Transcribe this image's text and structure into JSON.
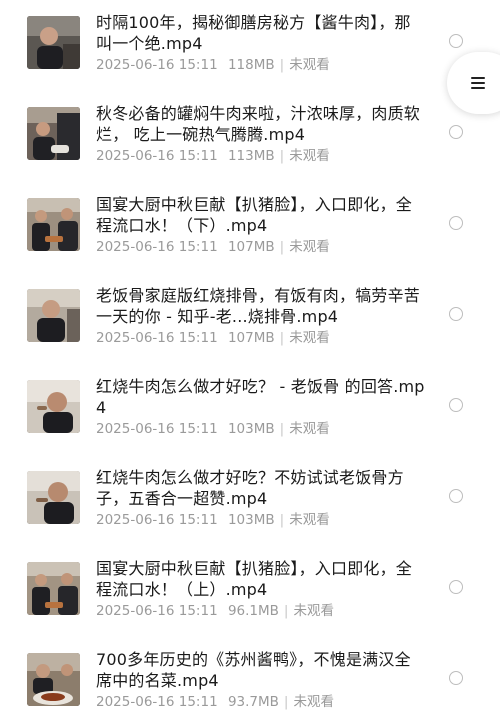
{
  "videos": [
    {
      "title": "时隔100年，揭秘御膳房秘方【酱牛肉】，那叫一个绝.mp4",
      "date": "2025-06-16 15:11",
      "size": "118MB",
      "status": "未观看",
      "thumbnail_icon": "chef-portrait-thumbnail"
    },
    {
      "title": "秋冬必备的罐焖牛肉来啦，汁浓味厚，肉质软烂， 吃上一碗热气腾腾.mp4",
      "date": "2025-06-16 15:11",
      "size": "113MB",
      "status": "未观看",
      "thumbnail_icon": "chef-cooking-thumbnail"
    },
    {
      "title": "国宴大厨中秋巨献【扒猪脸】，入口即化，全程流口水！（下）.mp4",
      "date": "2025-06-16 15:11",
      "size": "107MB",
      "status": "未观看",
      "thumbnail_icon": "two-chefs-thumbnail"
    },
    {
      "title": "老饭骨家庭版红烧排骨，有饭有肉，犒劳辛苦一天的你 - 知乎-老...烧排骨.mp4",
      "date": "2025-06-16 15:11",
      "size": "107MB",
      "status": "未观看",
      "thumbnail_icon": "chef-portrait-thumbnail"
    },
    {
      "title": "红烧牛肉怎么做才好吃？ - 老饭骨 的回答.mp4",
      "date": "2025-06-16 15:11",
      "size": "103MB",
      "status": "未观看",
      "thumbnail_icon": "chef-tasting-thumbnail"
    },
    {
      "title": "红烧牛肉怎么做才好吃？不妨试试老饭骨方子，五香合一超赞.mp4",
      "date": "2025-06-16 15:11",
      "size": "103MB",
      "status": "未观看",
      "thumbnail_icon": "chef-tasting-thumbnail"
    },
    {
      "title": "国宴大厨中秋巨献【扒猪脸】，入口即化，全程流口水！（上）.mp4",
      "date": "2025-06-16 15:11",
      "size": "96.1MB",
      "status": "未观看",
      "thumbnail_icon": "two-chefs-thumbnail"
    },
    {
      "title": "700多年历史的《苏州酱鸭》，不愧是满汉全席中的名菜.mp4",
      "date": "2025-06-16 15:11",
      "size": "93.7MB",
      "status": "未观看",
      "thumbnail_icon": "duck-dish-thumbnail"
    }
  ],
  "menu_button": {
    "icon": "menu-icon"
  }
}
